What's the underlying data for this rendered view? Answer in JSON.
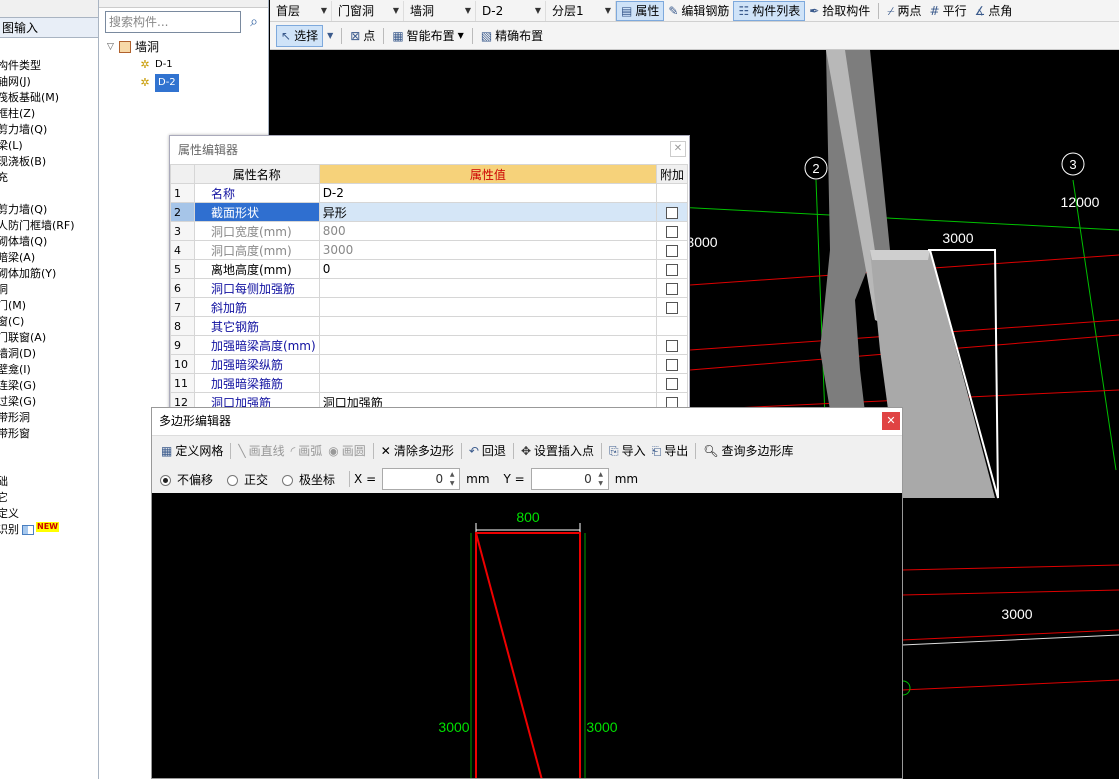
{
  "left_panel": {
    "title": "图输入",
    "items": [
      {
        "label": "构件类型"
      },
      {
        "label": "轴网(J)"
      },
      {
        "label": "筏板基础(M)"
      },
      {
        "label": "框柱(Z)"
      },
      {
        "label": "剪力墙(Q)"
      },
      {
        "label": "梁(L)"
      },
      {
        "label": "现浇板(B)"
      },
      {
        "label": "充"
      },
      {
        "label": ""
      },
      {
        "label": "剪力墙(Q)"
      },
      {
        "label": "人防门框墙(RF)"
      },
      {
        "label": "砌体墙(Q)"
      },
      {
        "label": "暗梁(A)"
      },
      {
        "label": "砌体加筋(Y)"
      },
      {
        "label": "洞"
      },
      {
        "label": "门(M)"
      },
      {
        "label": "窗(C)"
      },
      {
        "label": "门联窗(A)"
      },
      {
        "label": "墙洞(D)"
      },
      {
        "label": "壁龛(I)"
      },
      {
        "label": "连梁(G)"
      },
      {
        "label": "过梁(G)"
      },
      {
        "label": "带形洞"
      },
      {
        "label": "带形窗"
      },
      {
        "label": ""
      },
      {
        "label": ""
      },
      {
        "label": "础"
      },
      {
        "label": "它"
      },
      {
        "label": "定义"
      },
      {
        "label": "识别"
      }
    ],
    "new_badge": "NEW"
  },
  "tree": {
    "search_placeholder": "搜索构件...",
    "root_label": "墙洞",
    "children": [
      {
        "label": "D-1"
      },
      {
        "label": "D-2"
      }
    ]
  },
  "toolbar1": {
    "floor": "首层",
    "category": "门窗洞",
    "type": "墙洞",
    "component": "D-2",
    "layer": "分层1",
    "btn_property": "属性",
    "btn_edit_rebar": "编辑钢筋",
    "btn_component_list": "构件列表",
    "btn_pick": "拾取构件",
    "btn_two_points": "两点",
    "btn_parallel": "平行",
    "btn_point_angle": "点角"
  },
  "toolbar2": {
    "btn_select": "选择",
    "btn_point": "点",
    "btn_smart_layout": "智能布置",
    "btn_precise_layout": "精确布置"
  },
  "cad": {
    "axis_2": "2",
    "axis_3": "3",
    "dim_12000": "12000",
    "dim_3000_left": "3000",
    "dim_3000_top": "3000",
    "dim_3000_bottom": "3000"
  },
  "property_editor": {
    "title": "属性编辑器",
    "col_name": "属性名称",
    "col_value": "属性值",
    "col_add": "附加",
    "rows": [
      {
        "idx": "1",
        "name": "名称",
        "value": "D-2",
        "checkbox": false,
        "style": "blue"
      },
      {
        "idx": "2",
        "name": "截面形状",
        "value": "异形",
        "checkbox": true,
        "style": "sel"
      },
      {
        "idx": "3",
        "name": "洞口宽度(mm)",
        "value": "800",
        "checkbox": true,
        "style": "gray"
      },
      {
        "idx": "4",
        "name": "洞口高度(mm)",
        "value": "3000",
        "checkbox": true,
        "style": "gray"
      },
      {
        "idx": "5",
        "name": "离地高度(mm)",
        "value": "0",
        "checkbox": true,
        "style": "black"
      },
      {
        "idx": "6",
        "name": "洞口每侧加强筋",
        "value": "",
        "checkbox": true,
        "style": "blue"
      },
      {
        "idx": "7",
        "name": "斜加筋",
        "value": "",
        "checkbox": true,
        "style": "blue"
      },
      {
        "idx": "8",
        "name": "其它钢筋",
        "value": "",
        "checkbox": false,
        "style": "blue"
      },
      {
        "idx": "9",
        "name": "加强暗梁高度(mm)",
        "value": "",
        "checkbox": true,
        "style": "blue"
      },
      {
        "idx": "10",
        "name": "加强暗梁纵筋",
        "value": "",
        "checkbox": true,
        "style": "blue"
      },
      {
        "idx": "11",
        "name": "加强暗梁箍筋",
        "value": "",
        "checkbox": true,
        "style": "blue"
      },
      {
        "idx": "12",
        "name": "洞口加强筋",
        "value": "洞口加强筋",
        "checkbox": true,
        "style": "blue"
      }
    ]
  },
  "polygon_editor": {
    "title": "多边形编辑器",
    "btn_define_grid": "定义网格",
    "btn_draw_line": "画直线",
    "btn_draw_arc": "画弧",
    "btn_draw_circle": "画圆",
    "btn_clear": "清除多边形",
    "btn_undo": "回退",
    "btn_set_insert": "设置插入点",
    "btn_import": "导入",
    "btn_export": "导出",
    "btn_query_lib": "查询多边形库",
    "radio_no_offset": "不偏移",
    "radio_ortho": "正交",
    "radio_polar": "极坐标",
    "x_label": "X =",
    "x_value": "0",
    "y_label": "Y =",
    "y_value": "0",
    "unit": "mm",
    "dim_width": "800",
    "dim_left_height": "3000",
    "dim_right_height": "3000"
  }
}
